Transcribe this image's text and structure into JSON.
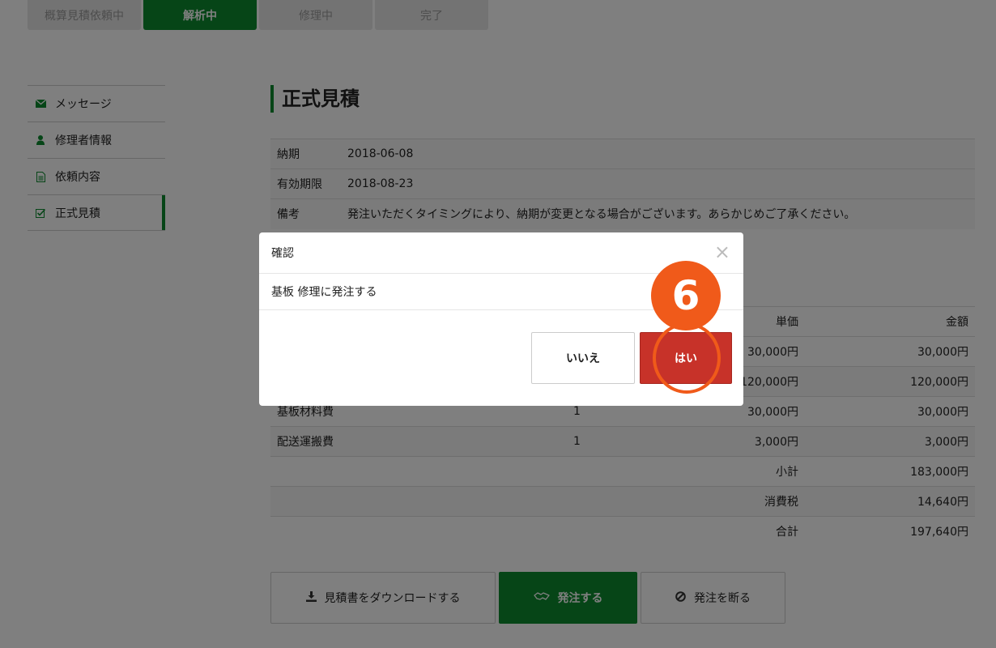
{
  "steps": [
    {
      "label": "概算見積依頼中"
    },
    {
      "label": "解析中"
    },
    {
      "label": "修理中"
    },
    {
      "label": "完了"
    }
  ],
  "sidebar": {
    "items": [
      {
        "label": "メッセージ",
        "icon": "envelope-icon"
      },
      {
        "label": "修理者情報",
        "icon": "user-icon"
      },
      {
        "label": "依頼内容",
        "icon": "document-icon"
      },
      {
        "label": "正式見積",
        "icon": "checkbox-icon"
      }
    ]
  },
  "main": {
    "title": "正式見積",
    "info": [
      {
        "key": "納期",
        "value": "2018-06-08"
      },
      {
        "key": "有効期限",
        "value": "2018-08-23"
      },
      {
        "key": "備考",
        "value": "発注いただくタイミングにより、納期が変更となる場合がございます。あらかじめご了承ください。"
      }
    ]
  },
  "estimate": {
    "headers": {
      "unit": "単価",
      "amount": "金額"
    },
    "rows": [
      {
        "name": "",
        "qty": "",
        "unit": "30,000円",
        "amount": "30,000円"
      },
      {
        "name": "",
        "qty": "",
        "unit": "120,000円",
        "amount": "120,000円"
      },
      {
        "name": "基板材料費",
        "qty": "1",
        "unit": "30,000円",
        "amount": "30,000円"
      },
      {
        "name": "配送運搬費",
        "qty": "1",
        "unit": "3,000円",
        "amount": "3,000円"
      }
    ],
    "subtotal_label": "小計",
    "subtotal": "183,000円",
    "tax_label": "消費税",
    "tax": "14,640円",
    "total_label": "合計",
    "total": "197,640円"
  },
  "actions": {
    "download": "見積書をダウンロードする",
    "order": "発注する",
    "decline": "発注を断る"
  },
  "modal": {
    "title": "確認",
    "message": "基板 修理に発注する",
    "no": "いいえ",
    "yes": "はい",
    "close": "×"
  },
  "marker": {
    "number": "6"
  },
  "colors": {
    "accent": "#0c8a2e",
    "danger": "#c73229",
    "marker": "#f05a1a"
  }
}
